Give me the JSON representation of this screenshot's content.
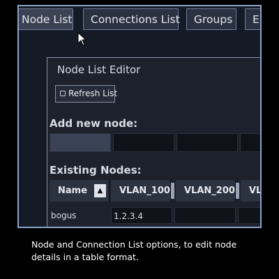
{
  "tabs": [
    "Node List",
    "Connections List",
    "Groups",
    "E"
  ],
  "editor": {
    "title": "Node List Editor",
    "refresh_label": "Refresh List",
    "add_new_label": "Add new node:",
    "existing_label": "Existing Nodes:"
  },
  "table": {
    "columns": [
      "Name",
      "VLAN_100",
      "VLAN_200",
      "VL"
    ],
    "sort_indicator": "▲",
    "rows": [
      {
        "name": "bogus",
        "vlan_100": "1.2.3.4",
        "vlan_200": "",
        "vl": ""
      }
    ]
  },
  "caption": "Node and Connection List options, to edit node details in a table format.",
  "icons": {
    "refresh": "refresh-icon",
    "cursor": "mouse-pointer-icon"
  },
  "colors": {
    "background": "#000000",
    "panel": "#141a26",
    "frame_border": "#8fa3c8"
  }
}
